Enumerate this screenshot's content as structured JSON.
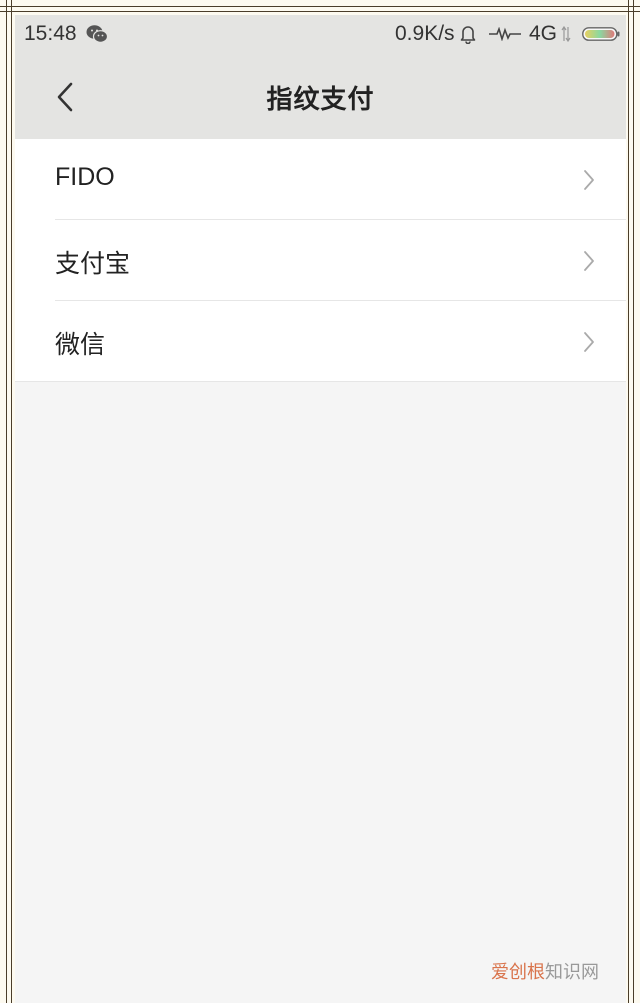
{
  "status_bar": {
    "time": "15:48",
    "net_speed": "0.9K/s",
    "net_type": "4G",
    "icons": [
      "wechat-icon",
      "bell-icon",
      "signal-icon",
      "data-arrows-icon",
      "battery-icon"
    ]
  },
  "header": {
    "back_icon": "chevron-left-icon",
    "title": "指纹支付"
  },
  "list": {
    "items": [
      {
        "label": "FIDO"
      },
      {
        "label": "支付宝"
      },
      {
        "label": "微信"
      }
    ]
  },
  "watermark": {
    "part1": "爱创根",
    "part2": "知识网"
  },
  "colors": {
    "header_bg": "#e4e4e2",
    "page_bg": "#f5f5f5",
    "list_bg": "#ffffff",
    "frame": "#4a3d2a",
    "watermark_accent": "#d9744c"
  }
}
